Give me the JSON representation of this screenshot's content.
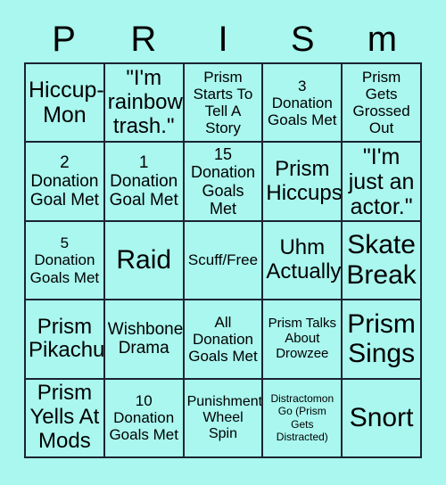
{
  "card": {
    "title_letters": [
      "P",
      "R",
      "I",
      "S",
      "m"
    ],
    "background_color": "#a9f7ef",
    "border_color": "#1b2430",
    "text_color": "#000000",
    "columns": 5,
    "rows": 5,
    "cells": [
      {
        "text": "Hiccup-Mon",
        "size": "xl"
      },
      {
        "text": "\"I'm rainbow trash.\"",
        "size": "xl"
      },
      {
        "text": "Prism Starts To Tell A Story",
        "size": "m"
      },
      {
        "text": "3 Donation Goals Met",
        "size": "m"
      },
      {
        "text": "Prism Gets Grossed Out",
        "size": "m"
      },
      {
        "text": "2 Donation Goal Met",
        "size": "l"
      },
      {
        "text": "1 Donation Goal Met",
        "size": "l"
      },
      {
        "text": "15 Donation Goals Met",
        "size": "l"
      },
      {
        "text": "Prism Hiccups",
        "size": "xl"
      },
      {
        "text": "\"I'm just an actor.\"",
        "size": "xl"
      },
      {
        "text": "5 Donation Goals Met",
        "size": "m"
      },
      {
        "text": "Raid",
        "size": "xxl"
      },
      {
        "text": "Scuff/Free",
        "size": "m"
      },
      {
        "text": "Uhm Actually",
        "size": "xl"
      },
      {
        "text": "Skate Break",
        "size": "xxl"
      },
      {
        "text": "Prism Pikachu",
        "size": "xl"
      },
      {
        "text": "Wishbone Drama",
        "size": "l"
      },
      {
        "text": "All Donation Goals Met",
        "size": "m"
      },
      {
        "text": "Prism Talks About Drowzee",
        "size": "s"
      },
      {
        "text": "Prism Sings",
        "size": "xxl"
      },
      {
        "text": "Prism Yells At Mods",
        "size": "xl"
      },
      {
        "text": "10 Donation Goals Met",
        "size": "m"
      },
      {
        "text": "Punishment Wheel Spin",
        "size": "m"
      },
      {
        "text": "Distractomon Go (Prism Gets Distracted)",
        "size": "xs"
      },
      {
        "text": "Snort",
        "size": "xxl"
      }
    ]
  }
}
